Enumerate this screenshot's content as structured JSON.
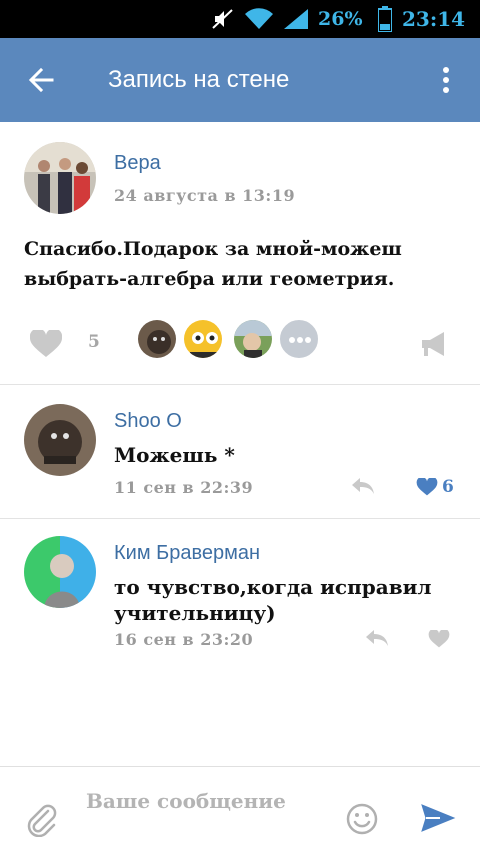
{
  "status_bar": {
    "battery": "26%",
    "time": "23:14"
  },
  "app_bar": {
    "title": "Запись на стене"
  },
  "post": {
    "author": "Вера",
    "date": "24 августа в 13:19",
    "text": "Спасибо.Подарок за мной-можеш выбрать-алгебра или геометрия.",
    "likes_count": "5"
  },
  "comments": [
    {
      "author": "Shoo O",
      "text": "Можешь *",
      "date": "11 сен в 22:39",
      "likes_count": "6",
      "liked": true
    },
    {
      "author": "Ким Браверман",
      "text": "то чувство,когда исправил учительницу)",
      "date": "16 сен в 23:20",
      "likes_count": "",
      "liked": false
    }
  ],
  "input": {
    "placeholder": "Ваше сообщение"
  },
  "colors": {
    "app_bar": "#5b88bd",
    "link": "#3d6ea3",
    "like_active": "#4a7fc1",
    "muted": "#9a9a9a"
  }
}
